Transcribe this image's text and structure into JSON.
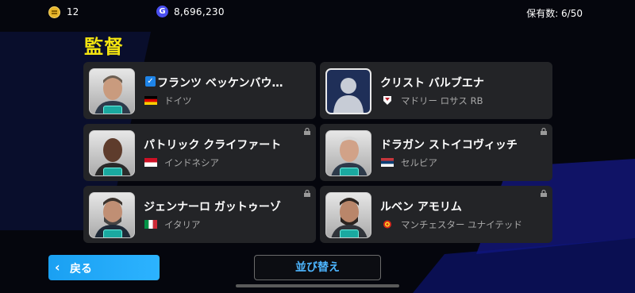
{
  "header": {
    "coins": "12",
    "gp": "8,696,230",
    "gp_icon_letter": "G",
    "slots": "保有数: 6/50"
  },
  "page_title": "監督",
  "managers": [
    {
      "name": "フランツ ベッケンバウ…",
      "team": "ドイツ",
      "flag": "germany-flag",
      "selected": true,
      "locked": false
    },
    {
      "name": "クリスト バルブエナ",
      "team": "マドリー ロサス RB",
      "flag": "club-crest",
      "selected": false,
      "locked": false
    },
    {
      "name": "パトリック クライファート",
      "team": "インドネシア",
      "flag": "indonesia-flag",
      "selected": false,
      "locked": true
    },
    {
      "name": "ドラガン ストイコヴィッチ",
      "team": "セルビア",
      "flag": "serbia-flag",
      "selected": false,
      "locked": true
    },
    {
      "name": "ジェンナーロ ガットゥーゾ",
      "team": "イタリア",
      "flag": "italy-flag",
      "selected": false,
      "locked": true
    },
    {
      "name": "ルベン アモリム",
      "team": "マンチェスター ユナイテッド",
      "flag": "manutd-crest",
      "selected": false,
      "locked": true
    }
  ],
  "buttons": {
    "back": "戻る",
    "back_icon": "chevron-left-icon",
    "sort": "並び替え"
  },
  "colors": {
    "title": "#f4e410",
    "accent": "#1aa0f2",
    "card": "#232427"
  }
}
